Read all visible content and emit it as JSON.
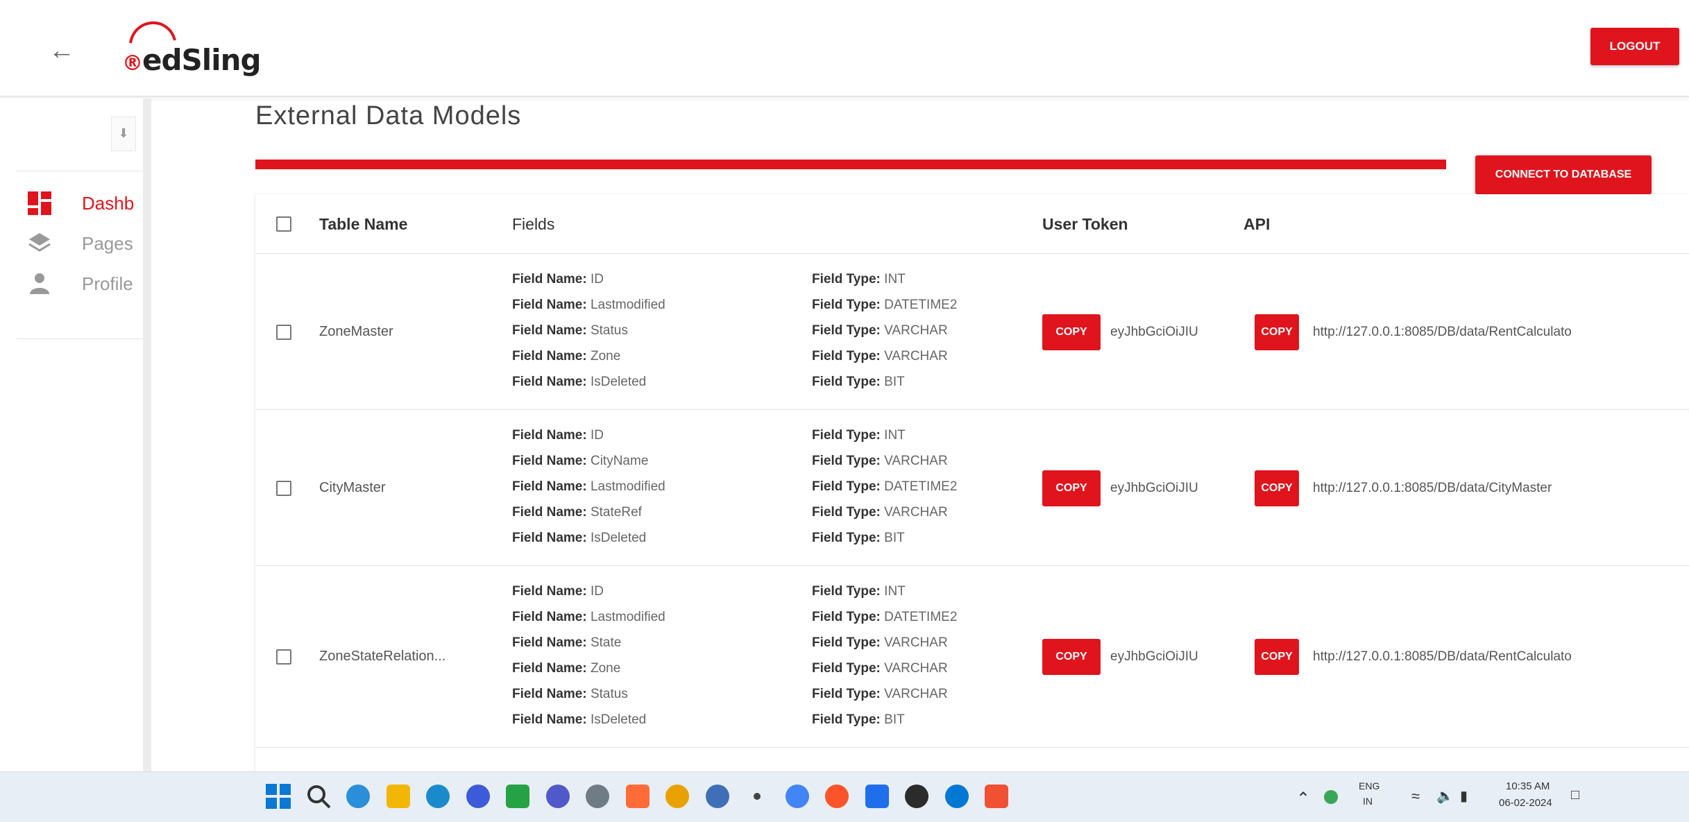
{
  "header": {
    "back_icon": "arrow-left-icon",
    "logo_text": "edSling",
    "logout_label": "LOGOUT"
  },
  "sidebar": {
    "pin_icon": "pin-icon",
    "items": [
      {
        "label": "Dashb",
        "icon": "dashboard-icon",
        "active": true
      },
      {
        "label": "Pages",
        "icon": "layers-icon",
        "active": false
      },
      {
        "label": "Profile",
        "icon": "person-icon",
        "active": false
      }
    ]
  },
  "main": {
    "title": "External Data Models",
    "connect_label": "CONNECT TO DATABASE",
    "columns": {
      "table_name": "Table Name",
      "fields": "Fields",
      "user_token": "User Token",
      "api": "API"
    },
    "field_name_label": "Field Name:",
    "field_type_label": "Field Type:",
    "copy_label": "COPY",
    "rows": [
      {
        "table_name": "ZoneMaster",
        "field_names": [
          "ID",
          "Lastmodified",
          "Status",
          "Zone",
          "IsDeleted"
        ],
        "field_types": [
          "INT",
          "DATETIME2",
          "VARCHAR",
          "VARCHAR",
          "BIT"
        ],
        "token": "eyJhbGciOiJIU",
        "api": "http://127.0.0.1:8085/DB/data/RentCalculato"
      },
      {
        "table_name": "CityMaster",
        "field_names": [
          "ID",
          "CityName",
          "Lastmodified",
          "StateRef",
          "IsDeleted"
        ],
        "field_types": [
          "INT",
          "VARCHAR",
          "DATETIME2",
          "VARCHAR",
          "BIT"
        ],
        "token": "eyJhbGciOiJIU",
        "api": "http://127.0.0.1:8085/DB/data/CityMaster"
      },
      {
        "table_name": "ZoneStateRelation...",
        "field_names": [
          "ID",
          "Lastmodified",
          "State",
          "Zone",
          "Status",
          "IsDeleted"
        ],
        "field_types": [
          "INT",
          "DATETIME2",
          "VARCHAR",
          "VARCHAR",
          "VARCHAR",
          "BIT"
        ],
        "token": "eyJhbGciOiJIU",
        "api": "http://127.0.0.1:8085/DB/data/RentCalculato"
      }
    ]
  },
  "taskbar": {
    "icons": [
      "windows-start-icon",
      "search-icon",
      "widgets-icon",
      "file-explorer-icon",
      "edge-icon",
      "terminal-icon",
      "whatsapp-icon",
      "teams-icon",
      "settings-icon",
      "postman-icon",
      "chrome-icon",
      "notepad-icon",
      "dot-icon",
      "chrome-icon",
      "brave-icon",
      "jetbrains-icon",
      "mail-icon",
      "vscode-icon",
      "git-icon"
    ],
    "lang_top": "ENG",
    "lang_bottom": "IN",
    "time": "10:35 AM",
    "date": "06-02-2024"
  }
}
